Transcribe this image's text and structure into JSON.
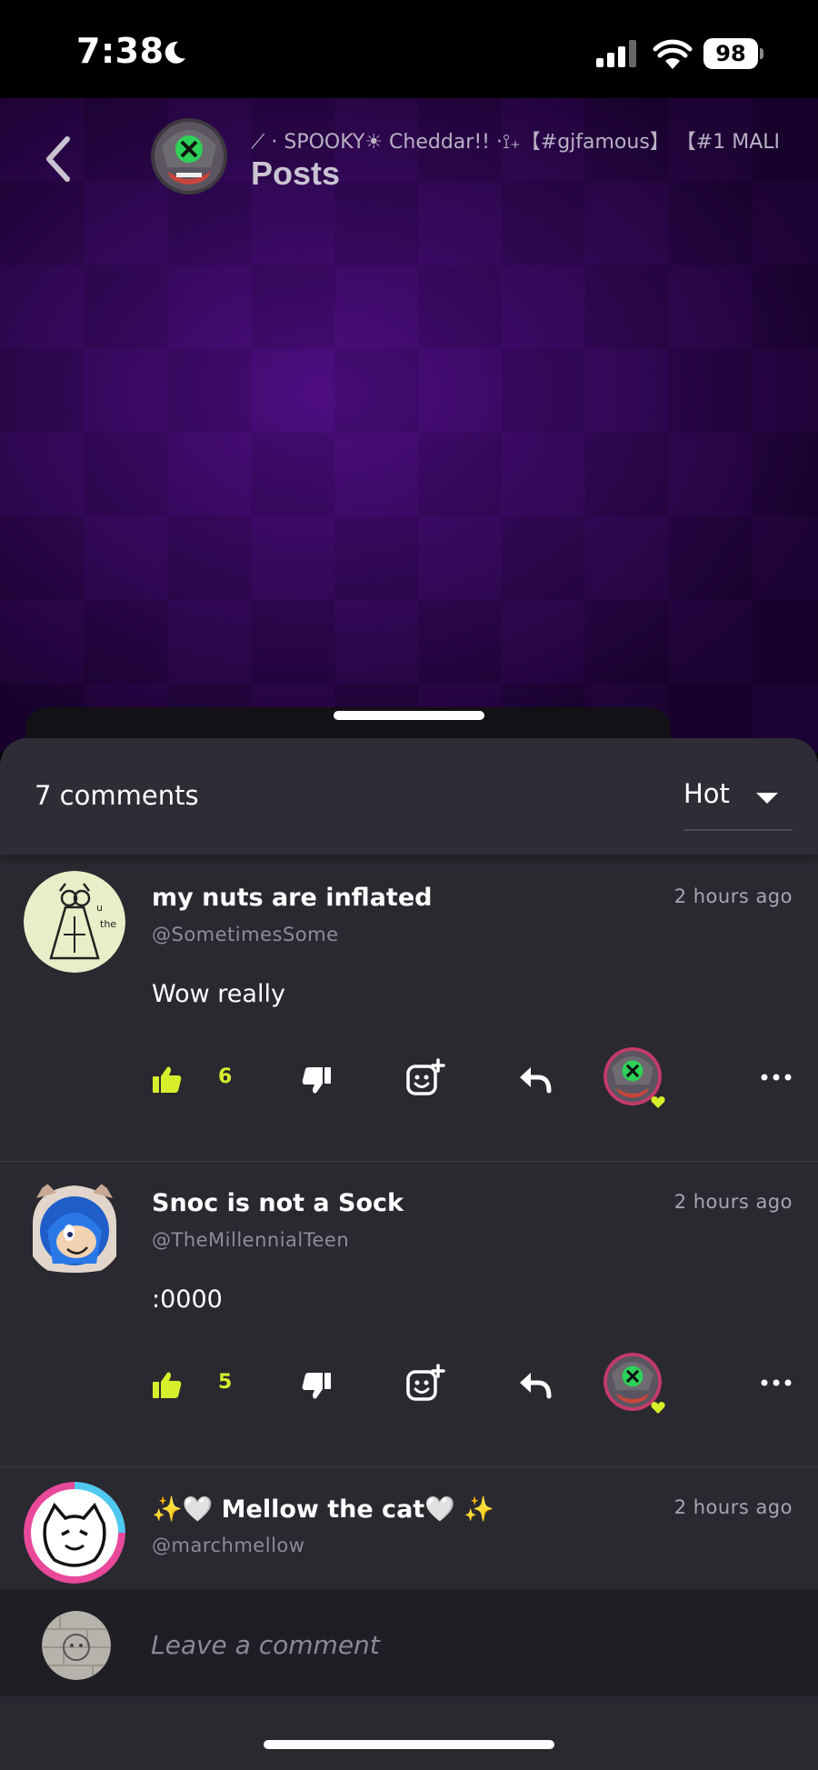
{
  "status_bar": {
    "time": "7:38",
    "battery": "98"
  },
  "header": {
    "channel_name": "⟋ · SPOOKY☀ Cheddar!! ·⟟₊【#gjfamous】 【#1 MALI",
    "title": "Posts"
  },
  "comments_header": {
    "count_label": "7 comments",
    "sort_value": "Hot"
  },
  "comments": [
    {
      "name": "my nuts are inflated",
      "handle": "@SometimesSome",
      "time": "2 hours ago",
      "body": "Wow really",
      "likes": "6"
    },
    {
      "name": "Snoc is not a Sock",
      "handle": "@TheMillennialTeen",
      "time": "2 hours ago",
      "body": ":0000",
      "likes": "5"
    },
    {
      "name": "✨🤍 Mellow the cat🤍 ✨",
      "handle": "@marchmellow",
      "time": "2 hours ago"
    }
  ],
  "composer": {
    "placeholder": "Leave a comment"
  },
  "colors": {
    "accent": "#d7ef2a",
    "sheet": "#2a2930",
    "background": "#2a0745"
  }
}
